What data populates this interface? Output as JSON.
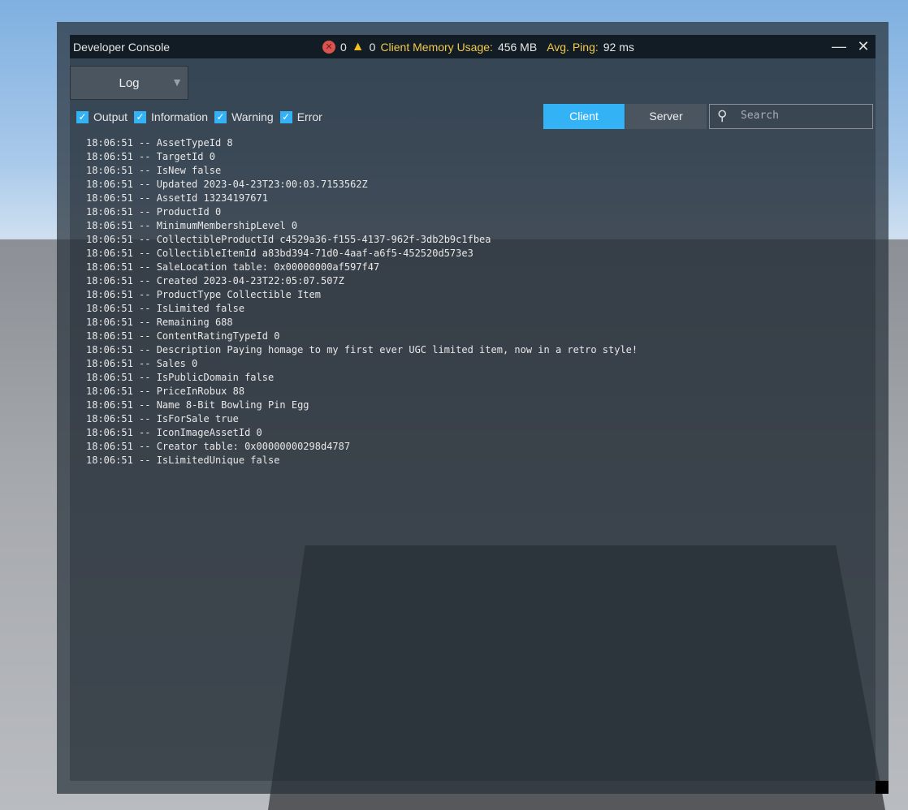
{
  "titlebar": {
    "title": "Developer Console",
    "error_count": "0",
    "warning_count": "0",
    "memory_label": "Client Memory Usage:",
    "memory_value": "456 MB",
    "ping_label": "Avg. Ping:",
    "ping_value": "92 ms",
    "minimize": "—",
    "close": "✕"
  },
  "view_dropdown": {
    "selected": "Log",
    "arrow": "▼"
  },
  "filters": [
    {
      "label": "Output",
      "checked": true
    },
    {
      "label": "Information",
      "checked": true
    },
    {
      "label": "Warning",
      "checked": true
    },
    {
      "label": "Error",
      "checked": true
    }
  ],
  "tabs": {
    "client": "Client",
    "server": "Server"
  },
  "search": {
    "placeholder": "Search",
    "value": ""
  },
  "log": [
    "18:06:51 -- AssetTypeId 8",
    "18:06:51 -- TargetId 0",
    "18:06:51 -- IsNew false",
    "18:06:51 -- Updated 2023-04-23T23:00:03.7153562Z",
    "18:06:51 -- AssetId 13234197671",
    "18:06:51 -- ProductId 0",
    "18:06:51 -- MinimumMembershipLevel 0",
    "18:06:51 -- CollectibleProductId c4529a36-f155-4137-962f-3db2b9c1fbea",
    "18:06:51 -- CollectibleItemId a83bd394-71d0-4aaf-a6f5-452520d573e3",
    "18:06:51 -- SaleLocation table: 0x00000000af597f47",
    "18:06:51 -- Created 2023-04-23T22:05:07.507Z",
    "18:06:51 -- ProductType Collectible Item",
    "18:06:51 -- IsLimited false",
    "18:06:51 -- Remaining 688",
    "18:06:51 -- ContentRatingTypeId 0",
    "18:06:51 -- Description Paying homage to my first ever UGC limited item, now in a retro style!",
    "18:06:51 -- Sales 0",
    "18:06:51 -- IsPublicDomain false",
    "18:06:51 -- PriceInRobux 88",
    "18:06:51 -- Name 8-Bit Bowling Pin Egg",
    "18:06:51 -- IsForSale true",
    "18:06:51 -- IconImageAssetId 0",
    "18:06:51 -- Creator table: 0x00000000298d4787",
    "18:06:51 -- IsLimitedUnique false"
  ],
  "colors": {
    "accent": "#33b3f5",
    "stat_label": "#f2c94c",
    "error": "#d9534f",
    "warning": "#f0c020"
  }
}
